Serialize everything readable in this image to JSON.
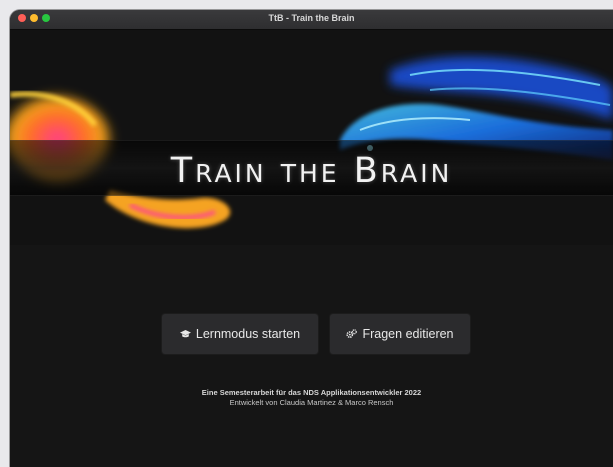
{
  "window": {
    "title": "TtB - Train the Brain"
  },
  "banner": {
    "logo_text": "Train the Brain"
  },
  "buttons": {
    "learn_mode": {
      "label": "Lernmodus starten",
      "icon": "graduation-cap-icon"
    },
    "edit_questions": {
      "label": "Fragen editieren",
      "icon": "gears-icon"
    }
  },
  "footer": {
    "line1": "Eine Semesterarbeit für das NDS Applikationsentwickler 2022",
    "line2": "Entwickelt von Claudia Martinez & Marco Rensch"
  },
  "colors": {
    "background": "#151515",
    "button_bg": "#2b2b2d",
    "text": "#e8e8e8",
    "close": "#ff5f57",
    "minimize": "#febc2e",
    "maximize": "#28c840"
  }
}
